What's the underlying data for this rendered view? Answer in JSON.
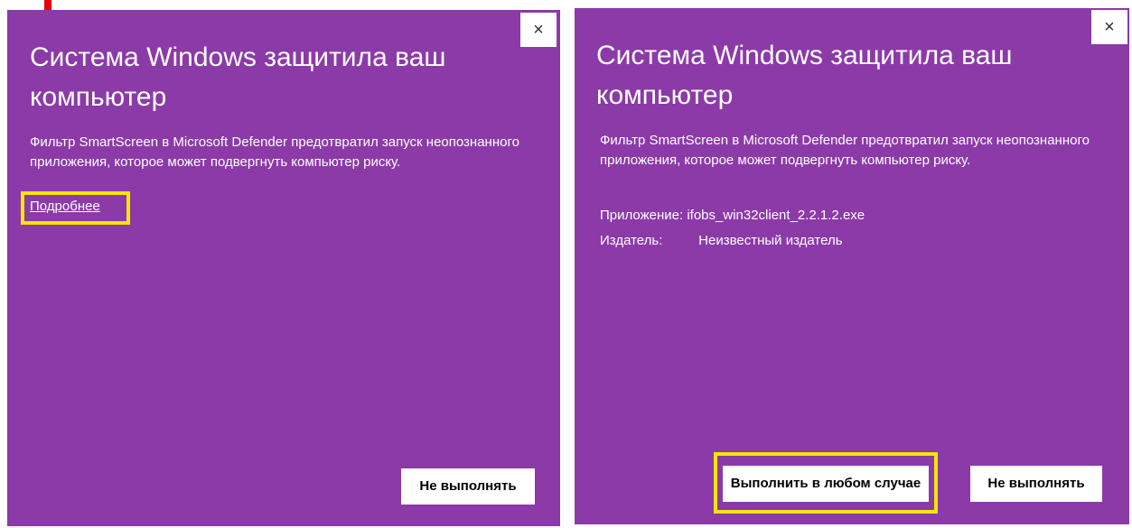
{
  "left_dialog": {
    "close_glyph": "×",
    "title": "Система Windows защитила ваш компьютер",
    "description": "Фильтр SmartScreen в Microsoft Defender предотвратил запуск неопознанного приложения, которое может подвергнуть компьютер риску.",
    "more_link": "Подробнее",
    "dont_run_label": "Не выполнять"
  },
  "right_dialog": {
    "close_glyph": "×",
    "title": "Система Windows защитила ваш компьютер",
    "description": "Фильтр SmartScreen в Microsoft Defender предотвратил запуск неопознанного приложения, которое может подвергнуть компьютер риску.",
    "app_label": "Приложение:",
    "app_value": "ifobs_win32client_2.2.1.2.exe",
    "publisher_label": "Издатель:",
    "publisher_value": "Неизвестный издатель",
    "run_anyway_label": "Выполнить в любом случае",
    "dont_run_label": "Не выполнять"
  },
  "colors": {
    "dialog_background": "#8b3aa8",
    "highlight": "#f4e600",
    "marker": "#e8000a"
  }
}
